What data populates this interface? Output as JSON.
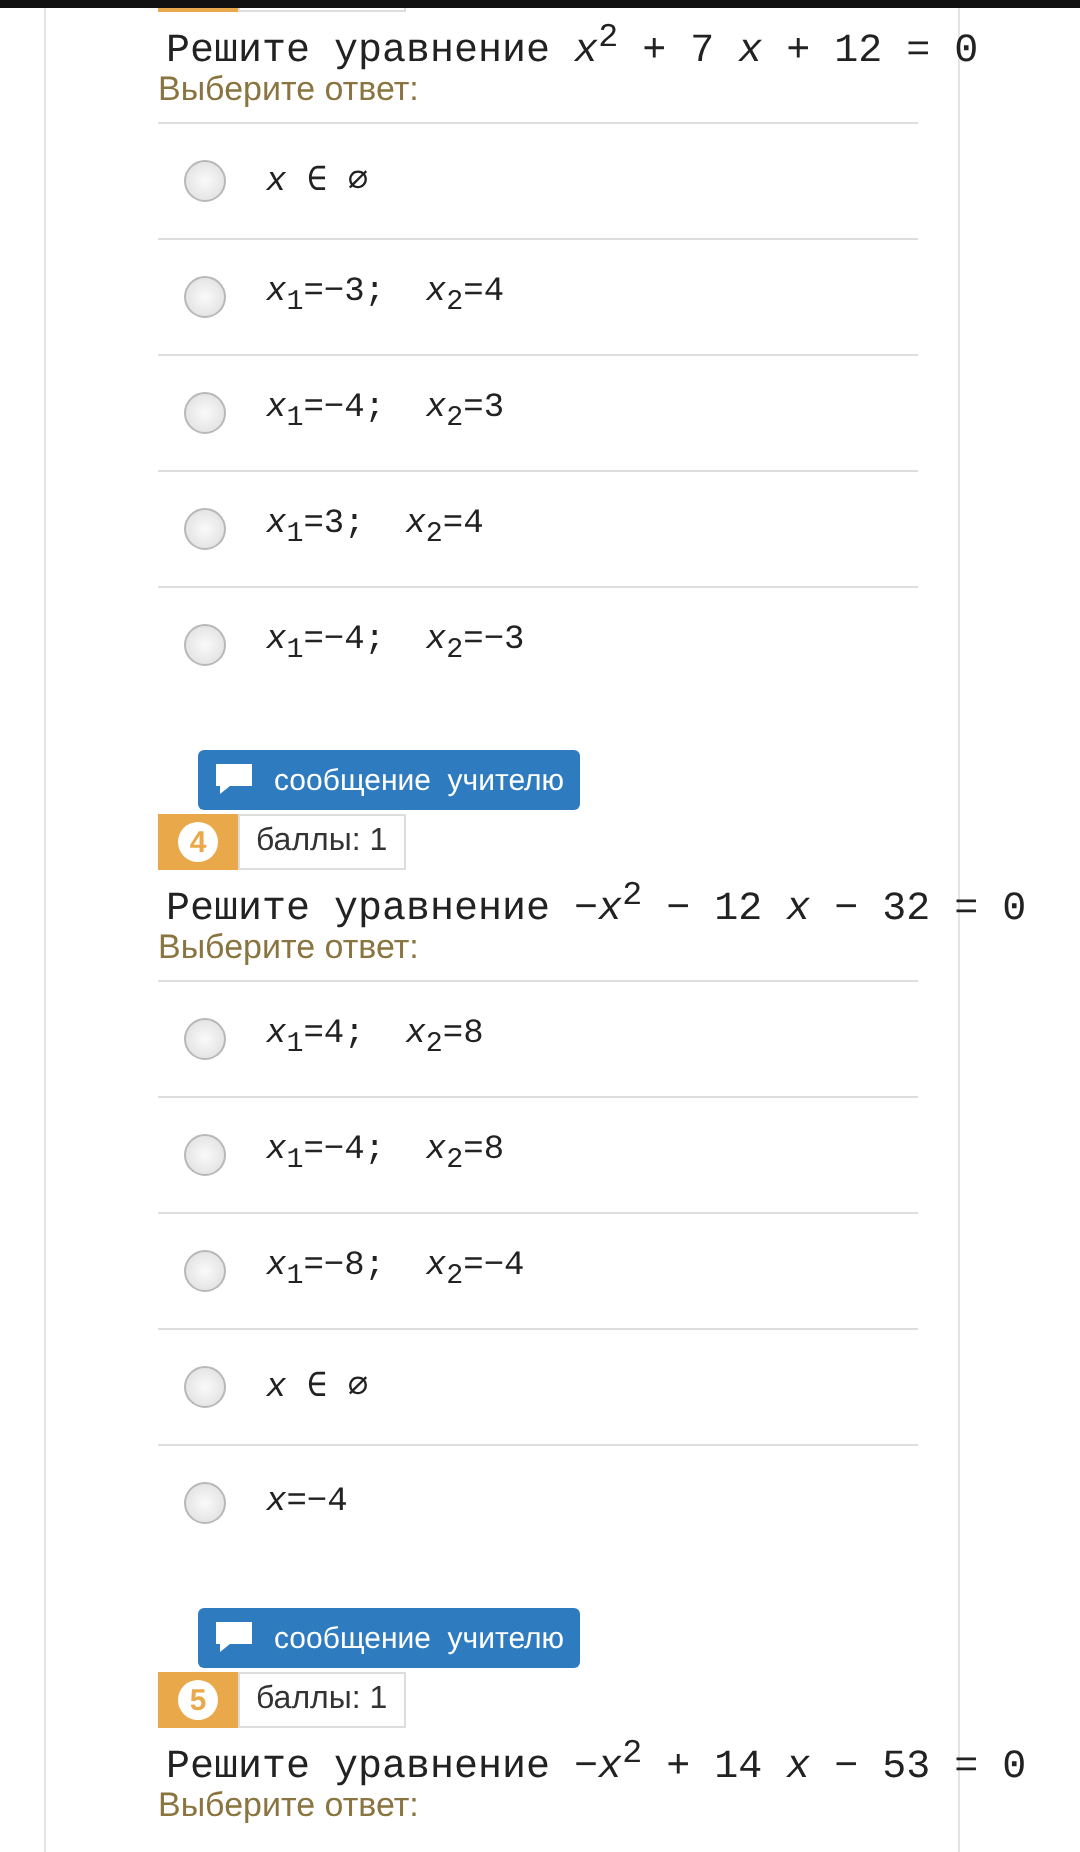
{
  "questions": [
    {
      "title": "Решите уравнение *x*$^{2}$ + 7 *x* + 12 = 0",
      "prompt": "Выберите ответ:",
      "options": [
        {
          "text": "*x* ∈ ∅",
          "selected": false
        },
        {
          "text": "*x*$_{1}$=−3;  *x*$_{2}$=4",
          "selected": false
        },
        {
          "text": "*x*$_{1}$=−4;  *x*$_{2}$=3",
          "selected": false
        },
        {
          "text": "*x*$_{1}$=3;  *x*$_{2}$=4",
          "selected": false
        },
        {
          "text": "*x*$_{1}$=−4;  *x*$_{2}$=−3",
          "selected": false
        }
      ]
    },
    {
      "message_button": "сообщение  учителю",
      "number": "4",
      "points": "баллы: 1",
      "title": "Решите уравнение −*x*$^{2}$ − 12 *x* − 32 = 0",
      "prompt": "Выберите ответ:",
      "options": [
        {
          "text": "*x*$_{1}$=4;  *x*$_{2}$=8",
          "selected": false
        },
        {
          "text": "*x*$_{1}$=−4;  *x*$_{2}$=8",
          "selected": false
        },
        {
          "text": "*x*$_{1}$=−8;  *x*$_{2}$=−4",
          "selected": false
        },
        {
          "text": "*x* ∈ ∅",
          "selected": false
        },
        {
          "text": "*x*=−4",
          "selected": false
        }
      ]
    },
    {
      "message_button": "сообщение  учителю",
      "number": "5",
      "points": "баллы: 1",
      "title": "Решите уравнение −*x*$^{2}$ + 14 *x* − 53 = 0",
      "prompt": "Выберите ответ:"
    }
  ]
}
